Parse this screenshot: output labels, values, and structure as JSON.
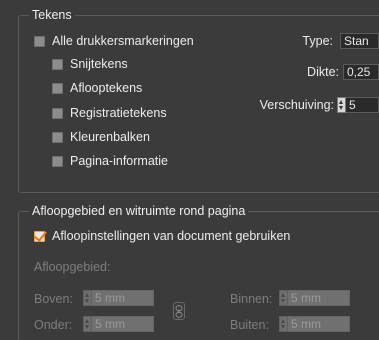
{
  "marks": {
    "title": "Tekens",
    "all_marks_label": "Alle drukkersmarkeringen",
    "items": [
      {
        "label": "Snijtekens"
      },
      {
        "label": "Aflooptekens"
      },
      {
        "label": "Registratietekens"
      },
      {
        "label": "Kleurenbalken"
      },
      {
        "label": "Pagina-informatie"
      }
    ],
    "type_label": "Type:",
    "type_value": "Stan",
    "thickness_label": "Dikte:",
    "thickness_value": "0,25",
    "offset_label": "Verschuiving:",
    "offset_value": "5"
  },
  "bleed": {
    "title": "Afloopgebied en witruimte rond pagina",
    "use_doc_settings_label": "Afloopinstellingen van document gebruiken",
    "use_doc_settings_checked": true,
    "bleed_label": "Afloopgebied:",
    "top_label": "Boven:",
    "top_value": "5 mm",
    "bottom_label": "Onder:",
    "bottom_value": "5 mm",
    "inside_label": "Binnen:",
    "inside_value": "5 mm",
    "outside_label": "Buiten:",
    "outside_value": "5 mm",
    "link_icon": "chain-link-icon"
  }
}
